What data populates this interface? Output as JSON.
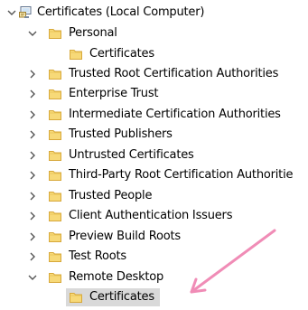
{
  "tree": {
    "root": {
      "label": "Certificates (Local Computer)",
      "icon": "certificate-store-computer-icon",
      "state": "expanded"
    },
    "items": [
      {
        "label": "Personal",
        "state": "expanded",
        "level": 1,
        "icon": "folder-icon"
      },
      {
        "label": "Certificates",
        "state": "leaf",
        "level": 2,
        "icon": "folder-icon"
      },
      {
        "label": "Trusted Root Certification Authorities",
        "state": "collapsed",
        "level": 1,
        "icon": "folder-icon"
      },
      {
        "label": "Enterprise Trust",
        "state": "collapsed",
        "level": 1,
        "icon": "folder-icon"
      },
      {
        "label": "Intermediate Certification Authorities",
        "state": "collapsed",
        "level": 1,
        "icon": "folder-icon"
      },
      {
        "label": "Trusted Publishers",
        "state": "collapsed",
        "level": 1,
        "icon": "folder-icon"
      },
      {
        "label": "Untrusted Certificates",
        "state": "collapsed",
        "level": 1,
        "icon": "folder-icon"
      },
      {
        "label": "Third-Party Root Certification Authoritie",
        "state": "collapsed",
        "level": 1,
        "icon": "folder-icon"
      },
      {
        "label": "Trusted People",
        "state": "collapsed",
        "level": 1,
        "icon": "folder-icon"
      },
      {
        "label": "Client Authentication Issuers",
        "state": "collapsed",
        "level": 1,
        "icon": "folder-icon"
      },
      {
        "label": "Preview Build Roots",
        "state": "collapsed",
        "level": 1,
        "icon": "folder-icon"
      },
      {
        "label": "Test Roots",
        "state": "collapsed",
        "level": 1,
        "icon": "folder-icon"
      },
      {
        "label": "Remote Desktop",
        "state": "expanded",
        "level": 1,
        "icon": "folder-icon"
      },
      {
        "label": "Certificates",
        "state": "leaf",
        "level": 2,
        "icon": "folder-icon",
        "selected": true
      }
    ]
  },
  "annotation": {
    "icon": "pointing-arrow-icon",
    "color": "#f08cb6"
  },
  "colors": {
    "selection": "#d9d9d9",
    "folder_fill": "#f7d978",
    "folder_stroke": "#d7a83a",
    "chevron": "#555555"
  }
}
